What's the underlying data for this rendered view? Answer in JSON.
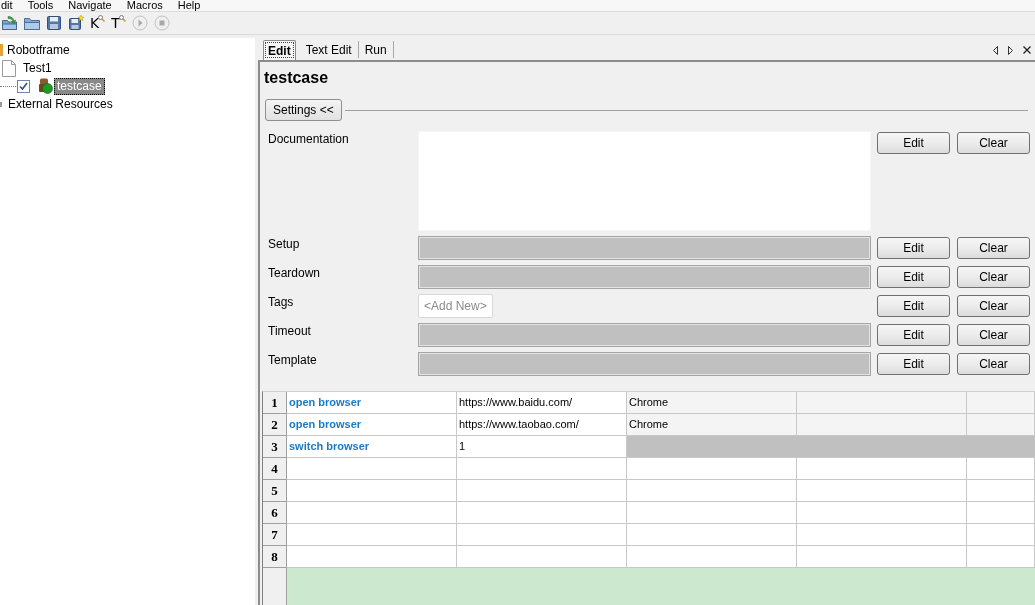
{
  "menu_bar": {
    "items": [
      "dit",
      "Tools",
      "Navigate",
      "Macros",
      "Help"
    ]
  },
  "toolbar": {
    "buttons": [
      {
        "kind": "open",
        "disabled": false
      },
      {
        "kind": "folder",
        "disabled": false
      },
      {
        "kind": "save",
        "disabled": false
      },
      {
        "kind": "save_all",
        "disabled": false
      },
      {
        "kind": "search",
        "label": "K",
        "disabled": false
      },
      {
        "kind": "search",
        "label": "T",
        "disabled": false
      },
      {
        "kind": "run",
        "disabled": true
      },
      {
        "kind": "stop",
        "disabled": true
      }
    ]
  },
  "tree": {
    "items": [
      {
        "label": "Robotframe",
        "kind": "project",
        "selected": false,
        "children": [
          {
            "label": "Test1",
            "kind": "suite",
            "selected": false,
            "children": [
              {
                "label": "testcase",
                "kind": "test",
                "selected": true,
                "checked": true
              }
            ]
          }
        ]
      },
      {
        "label": "External Resources",
        "kind": "resources",
        "selected": false
      }
    ]
  },
  "editor": {
    "tabs": [
      {
        "label": "Edit",
        "selected": true
      },
      {
        "label": "Text Edit",
        "selected": false
      },
      {
        "label": "Run",
        "selected": false
      }
    ],
    "title": "testcase",
    "settings_toggle": "Settings <<",
    "settings": [
      {
        "label": "Documentation",
        "kind": "documentation",
        "buttons": [
          "Edit",
          "Clear"
        ]
      },
      {
        "label": "Setup",
        "kind": "value",
        "buttons": [
          "Edit",
          "Clear"
        ]
      },
      {
        "label": "Teardown",
        "kind": "value",
        "buttons": [
          "Edit",
          "Clear"
        ]
      },
      {
        "label": "Tags",
        "kind": "tags",
        "add_new": "<Add New>",
        "buttons": [
          "Edit",
          "Clear"
        ]
      },
      {
        "label": "Timeout",
        "kind": "value",
        "buttons": [
          "Edit",
          "Clear"
        ]
      },
      {
        "label": "Template",
        "kind": "value",
        "buttons": [
          "Edit",
          "Clear"
        ]
      }
    ],
    "grid": {
      "rows": [
        {
          "number": "1",
          "cells": [
            {
              "kind": "keyword",
              "text": "open browser"
            },
            {
              "kind": "argument",
              "text": "https://www.baidu.com/"
            },
            {
              "kind": "optional",
              "text": "Chrome"
            },
            {
              "kind": "optional"
            },
            {
              "kind": "optional"
            }
          ]
        },
        {
          "number": "2",
          "cells": [
            {
              "kind": "keyword",
              "text": "open browser"
            },
            {
              "kind": "argument",
              "text": "https://www.taobao.com/"
            },
            {
              "kind": "optional",
              "text": "Chrome"
            },
            {
              "kind": "optional"
            },
            {
              "kind": "optional"
            }
          ]
        },
        {
          "number": "3",
          "cells": [
            {
              "kind": "keyword",
              "text": "switch browser"
            },
            {
              "kind": "argument",
              "text": "1"
            },
            {
              "kind": "unavailable"
            },
            {
              "kind": "unavailable"
            },
            {
              "kind": "unavailable"
            }
          ]
        },
        {
          "number": "4",
          "cells": [
            {
              "kind": "empty"
            },
            {
              "kind": "empty"
            },
            {
              "kind": "empty"
            },
            {
              "kind": "empty"
            },
            {
              "kind": "empty"
            }
          ]
        },
        {
          "number": "5",
          "cells": [
            {
              "kind": "empty"
            },
            {
              "kind": "empty"
            },
            {
              "kind": "empty"
            },
            {
              "kind": "empty"
            },
            {
              "kind": "empty"
            }
          ]
        },
        {
          "number": "6",
          "cells": [
            {
              "kind": "empty"
            },
            {
              "kind": "empty"
            },
            {
              "kind": "empty"
            },
            {
              "kind": "empty"
            },
            {
              "kind": "empty"
            }
          ]
        },
        {
          "number": "7",
          "cells": [
            {
              "kind": "empty"
            },
            {
              "kind": "empty"
            },
            {
              "kind": "empty"
            },
            {
              "kind": "empty"
            },
            {
              "kind": "empty"
            }
          ]
        },
        {
          "number": "8",
          "cells": [
            {
              "kind": "empty"
            },
            {
              "kind": "empty"
            },
            {
              "kind": "empty"
            },
            {
              "kind": "empty"
            },
            {
              "kind": "empty"
            }
          ]
        }
      ]
    }
  }
}
